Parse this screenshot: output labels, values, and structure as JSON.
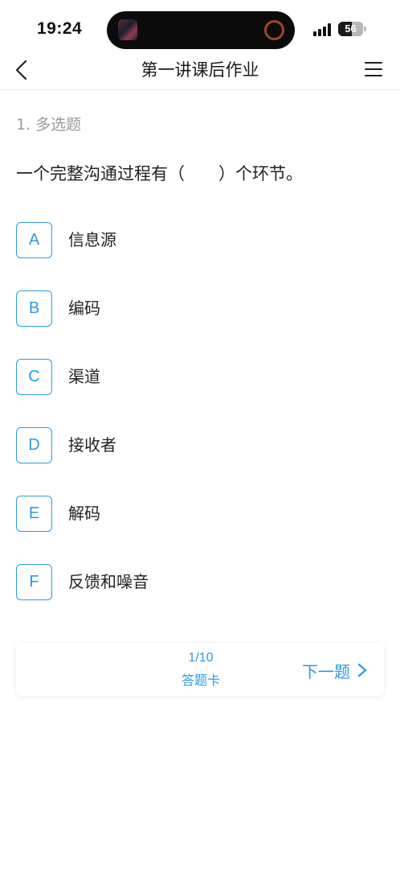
{
  "status_bar": {
    "time": "19:24",
    "battery": "56",
    "battery_level": 0.56
  },
  "nav": {
    "title": "第一讲课后作业",
    "back_icon": "chevron-left-icon",
    "menu_icon": "hamburger-menu-icon"
  },
  "question": {
    "type": "1. 多选题",
    "text": "一个完整沟通过程有（　　）个环节。",
    "options": [
      {
        "letter": "A",
        "text": "信息源"
      },
      {
        "letter": "B",
        "text": "编码"
      },
      {
        "letter": "C",
        "text": "渠道"
      },
      {
        "letter": "D",
        "text": "接收者"
      },
      {
        "letter": "E",
        "text": "解码"
      },
      {
        "letter": "F",
        "text": "反馈和噪音"
      }
    ]
  },
  "footer": {
    "progress": "1/10",
    "answer_card": "答题卡",
    "next_label": "下一题",
    "next_icon": "chevron-right-icon"
  },
  "colors": {
    "accent": "#2b9be3",
    "text": "#222222",
    "muted": "#9a9a9a"
  }
}
